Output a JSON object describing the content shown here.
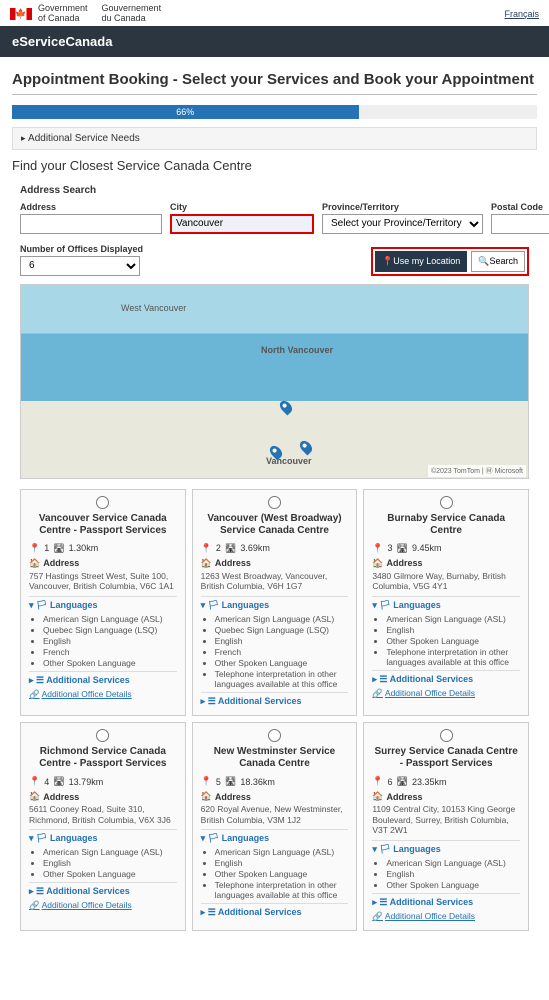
{
  "header": {
    "gov_en1": "Government",
    "gov_en2": "of Canada",
    "gov_fr1": "Gouvernement",
    "gov_fr2": "du Canada",
    "lang_link": "Français"
  },
  "banner": "eServiceCanada",
  "page_title": "Appointment Booking - Select your Services and Book your Appointment",
  "progress": {
    "pct_label": "66%"
  },
  "panel_additional": "Additional Service Needs",
  "subhead": "Find your Closest Service Canada Centre",
  "form": {
    "section": "Address Search",
    "address_label": "Address",
    "city_label": "City",
    "city_value": "Vancouver",
    "prov_label": "Province/Territory",
    "prov_placeholder": "Select your Province/Territory",
    "postal_label": "Postal Code",
    "num_label": "Number of Offices Displayed",
    "num_value": "6",
    "btn_location": "Use my Location",
    "btn_search": "Search"
  },
  "map": {
    "label_nv": "North Vancouver",
    "label_wv": "West Vancouver",
    "label_v": "Vancouver",
    "attrib": "©2023 TomTom | Ⓜ Microsoft"
  },
  "labels": {
    "address": "Address",
    "languages": "Languages",
    "additional_services": "Additional Services",
    "office_details": "Additional Office Details"
  },
  "cards": [
    {
      "title": "Vancouver Service Canada Centre - Passport Services",
      "rank": "1",
      "dist": "1.30km",
      "addr": "757 Hastings Street West, Suite 100, Vancouver, British Columbia, V6C 1A1",
      "langs": [
        "American Sign Language (ASL)",
        "Quebec Sign Language (LSQ)",
        "English",
        "French",
        "Other Spoken Language"
      ],
      "details_link": true
    },
    {
      "title": "Vancouver (West Broadway) Service Canada Centre",
      "rank": "2",
      "dist": "3.69km",
      "addr": "1263 West Broadway, Vancouver, British Columbia, V6H 1G7",
      "langs": [
        "American Sign Language (ASL)",
        "Quebec Sign Language (LSQ)",
        "English",
        "French",
        "Other Spoken Language",
        "Telephone interpretation in other languages available at this office"
      ],
      "details_link": false
    },
    {
      "title": "Burnaby Service Canada Centre",
      "rank": "3",
      "dist": "9.45km",
      "addr": "3480 Gilmore Way, Burnaby, British Columbia, V5G 4Y1",
      "langs": [
        "American Sign Language (ASL)",
        "English",
        "Other Spoken Language",
        "Telephone interpretation in other languages available at this office"
      ],
      "details_link": true
    },
    {
      "title": "Richmond Service Canada Centre - Passport Services",
      "rank": "4",
      "dist": "13.79km",
      "addr": "5611 Cooney Road, Suite 310, Richmond, British Columbia, V6X 3J6",
      "langs": [
        "American Sign Language (ASL)",
        "English",
        "Other Spoken Language"
      ],
      "details_link": true
    },
    {
      "title": "New Westminster Service Canada Centre",
      "rank": "5",
      "dist": "18.36km",
      "addr": "620 Royal Avenue, New Westminster, British Columbia, V3M 1J2",
      "langs": [
        "American Sign Language (ASL)",
        "English",
        "Other Spoken Language",
        "Telephone interpretation in other languages available at this office"
      ],
      "details_link": false
    },
    {
      "title": "Surrey Service Canada Centre - Passport Services",
      "rank": "6",
      "dist": "23.35km",
      "addr": "1109 Central City, 10153 King George Boulevard, Surrey, British Columbia, V3T 2W1",
      "langs": [
        "American Sign Language (ASL)",
        "English",
        "Other Spoken Language"
      ],
      "details_link": true
    }
  ]
}
